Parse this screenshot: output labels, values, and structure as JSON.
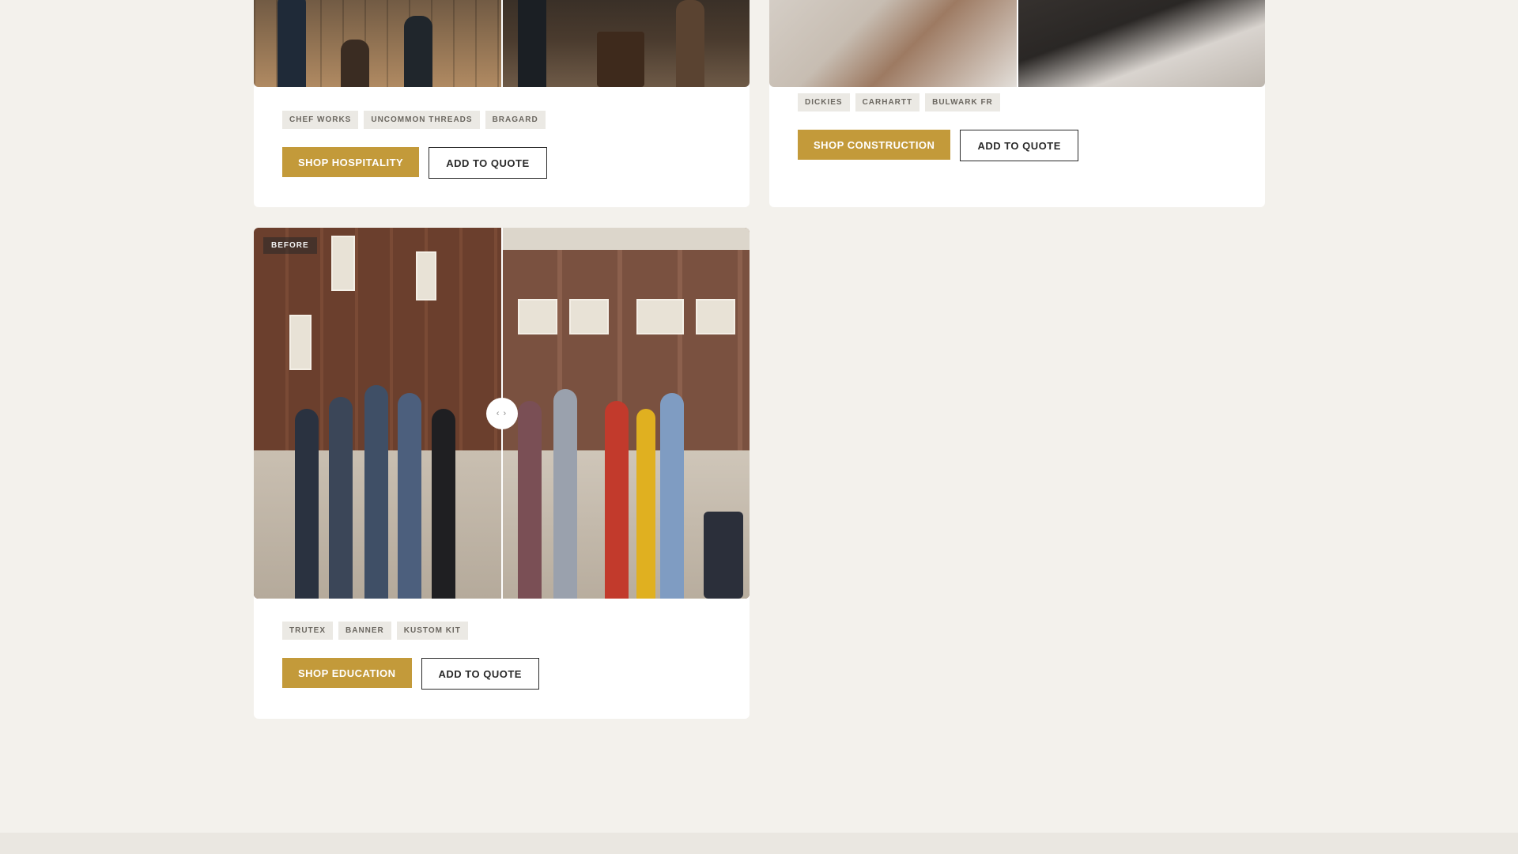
{
  "cards": [
    {
      "id": "hospitality",
      "tags": [
        "CHEF WORKS",
        "UNCOMMON THREADS",
        "BRAGARD"
      ],
      "shop_label": "SHOP HOSPITALITY",
      "quote_label": "ADD TO QUOTE"
    },
    {
      "id": "construction",
      "tags": [
        "DICKIES",
        "CARHARTT",
        "BULWARK FR"
      ],
      "shop_label": "SHOP CONSTRUCTION",
      "quote_label": "ADD TO QUOTE"
    },
    {
      "id": "education",
      "before_label": "BEFORE",
      "handle_glyph": "‹ ›",
      "tags": [
        "TRUTEX",
        "BANNER",
        "KUSTOM KIT"
      ],
      "shop_label": "SHOP EDUCATION",
      "quote_label": "ADD TO QUOTE"
    }
  ],
  "colors": {
    "background": "#f3f1ec",
    "accent_gold": "#c39a3a",
    "card": "#ffffff",
    "tag_bg": "#ebe9e4"
  }
}
